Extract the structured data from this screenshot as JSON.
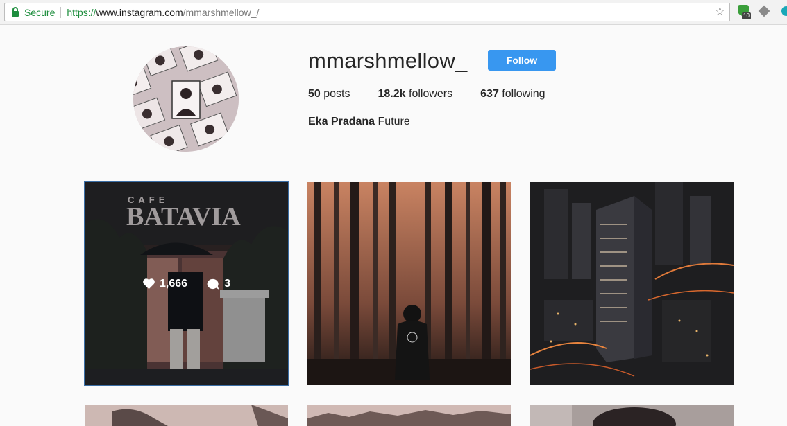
{
  "browser": {
    "secure_label": "Secure",
    "url_scheme": "https://",
    "url_host": "www.instagram.com",
    "url_path": "/mmarshmellow_/",
    "extension_badge": "10"
  },
  "profile": {
    "username": "mmarshmellow_",
    "follow_label": "Follow",
    "posts_count": "50",
    "posts_label": "posts",
    "followers_count": "18.2k",
    "followers_label": "followers",
    "following_count": "637",
    "following_label": "following",
    "full_name": "Eka Pradana",
    "bio": "Future"
  },
  "posts": [
    {
      "sign_text": "CAFE",
      "sign_text_2": "BATAVIA",
      "likes": "1,666",
      "comments": "3"
    },
    {},
    {},
    {},
    {},
    {}
  ],
  "colors": {
    "accent": "#3897f0",
    "secure_green": "#1e8e3e"
  }
}
